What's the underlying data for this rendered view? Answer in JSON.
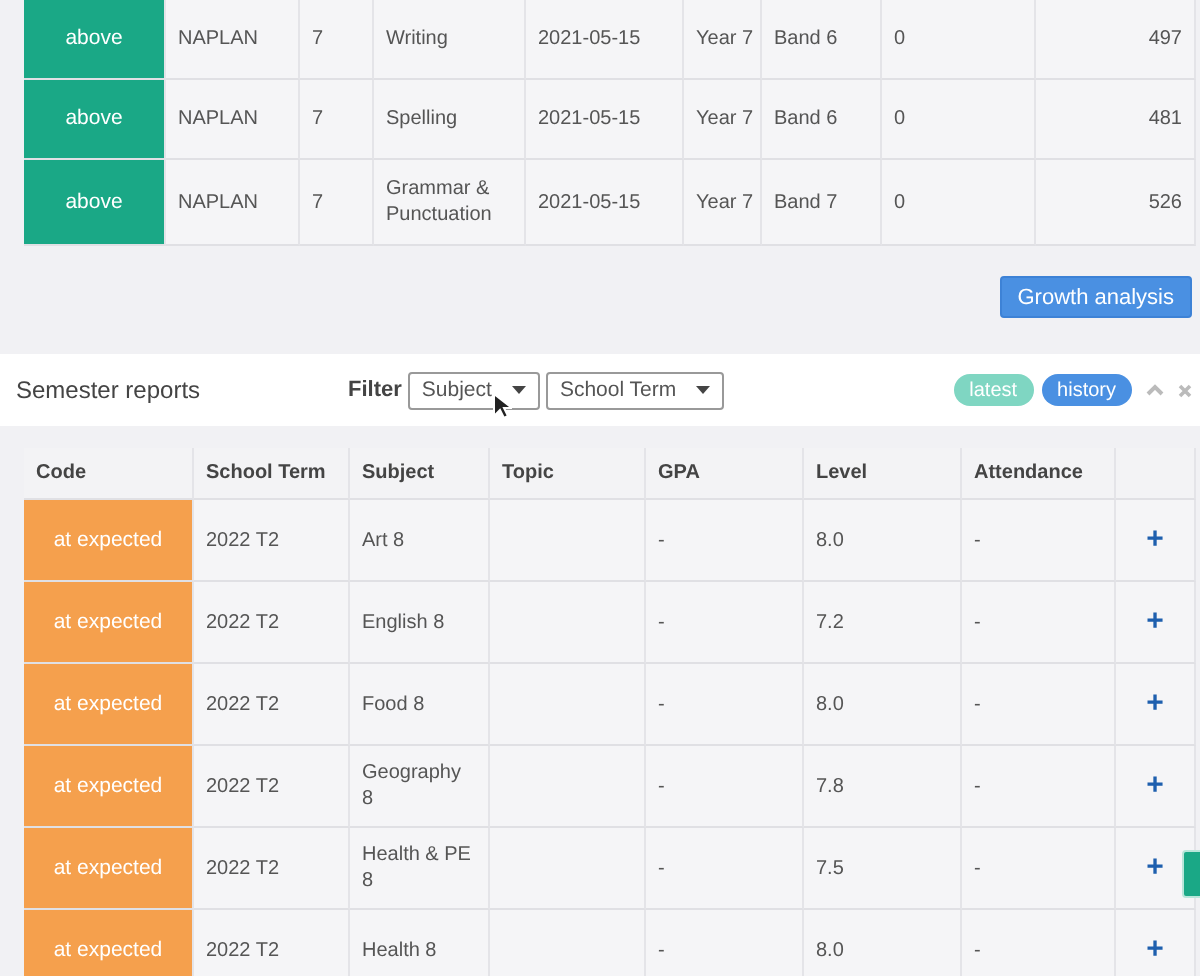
{
  "naplan_table": {
    "rows": [
      {
        "code": {
          "label": "above",
          "color": "#1aa886"
        },
        "cells": [
          "NAPLAN",
          "7",
          "Writing",
          "2021-05-15",
          "Year 7",
          "Band 6",
          "0",
          "497"
        ]
      },
      {
        "code": {
          "label": "above",
          "color": "#1aa886"
        },
        "cells": [
          "NAPLAN",
          "7",
          "Spelling",
          "2021-05-15",
          "Year 7",
          "Band 6",
          "0",
          "481"
        ]
      },
      {
        "code": {
          "label": "above",
          "color": "#1aa886"
        },
        "cells": [
          "NAPLAN",
          "7",
          "Grammar & Punctuation",
          "2021-05-15",
          "Year 7",
          "Band 7",
          "0",
          "526"
        ]
      }
    ]
  },
  "growth_button": "Growth analysis",
  "semester_reports": {
    "title": "Semester reports",
    "filter_label": "Filter",
    "filters": [
      {
        "label": "Subject"
      },
      {
        "label": "School Term"
      }
    ],
    "toggles": [
      {
        "label": "latest",
        "selected": false
      },
      {
        "label": "history",
        "selected": true
      }
    ],
    "code_column": "Code",
    "columns": [
      "School Term",
      "Subject",
      "Topic",
      "GPA",
      "Level",
      "Attendance"
    ],
    "rows": [
      {
        "code": {
          "label": "at expected",
          "color": "#f5a04d"
        },
        "cells": [
          "2022 T2",
          "Art 8",
          "",
          "-",
          "8.0",
          "-"
        ],
        "action": "+"
      },
      {
        "code": {
          "label": "at expected",
          "color": "#f5a04d"
        },
        "cells": [
          "2022 T2",
          "English 8",
          "",
          "-",
          "7.2",
          "-"
        ],
        "action": "+"
      },
      {
        "code": {
          "label": "at expected",
          "color": "#f5a04d"
        },
        "cells": [
          "2022 T2",
          "Food 8",
          "",
          "-",
          "8.0",
          "-"
        ],
        "action": "+"
      },
      {
        "code": {
          "label": "at expected",
          "color": "#f5a04d"
        },
        "cells": [
          "2022 T2",
          "Geography 8",
          "",
          "-",
          "7.8",
          "-"
        ],
        "action": "+"
      },
      {
        "code": {
          "label": "at expected",
          "color": "#f5a04d"
        },
        "cells": [
          "2022 T2",
          "Health & PE 8",
          "",
          "-",
          "7.5",
          "-"
        ],
        "action": "+"
      },
      {
        "code": {
          "label": "at expected",
          "color": "#f5a04d"
        },
        "cells": [
          "2022 T2",
          "Health 8",
          "",
          "-",
          "8.0",
          "-"
        ],
        "action": "+"
      }
    ]
  }
}
